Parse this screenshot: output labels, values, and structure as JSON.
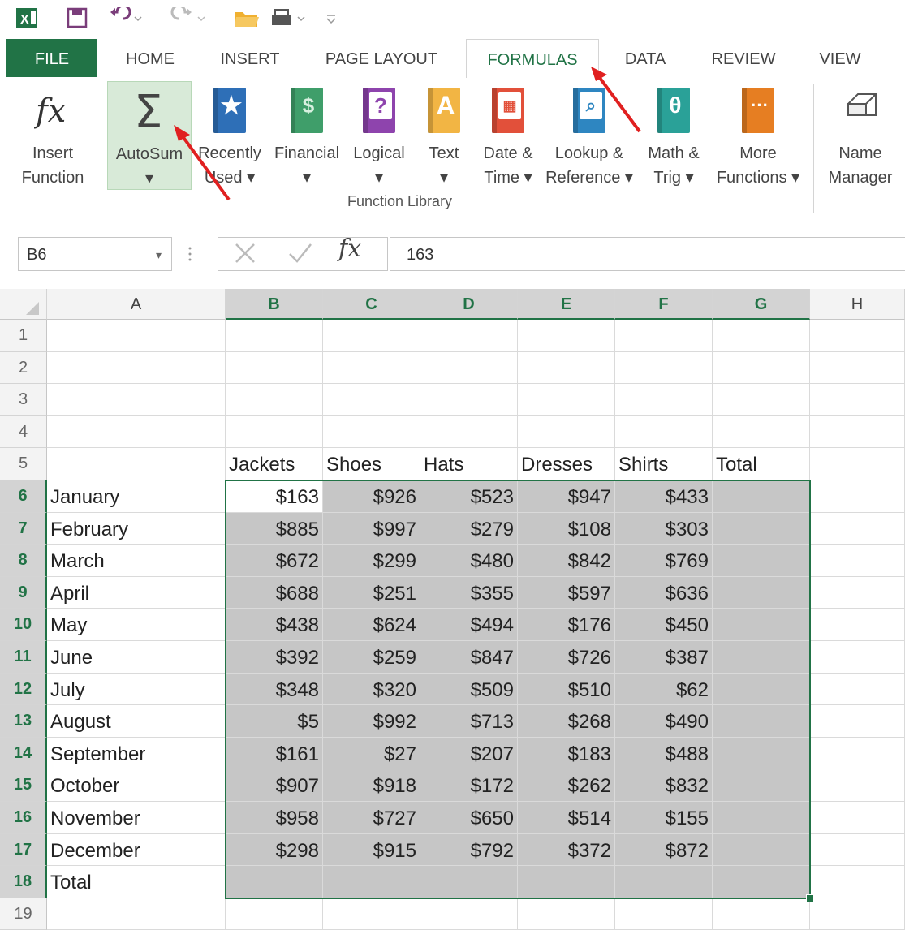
{
  "qat": {
    "icons": [
      "excel-logo-icon",
      "save-icon",
      "undo-icon",
      "redo-icon",
      "open-folder-icon",
      "print-icon",
      "customize-icon"
    ]
  },
  "tabs": [
    "FILE",
    "HOME",
    "INSERT",
    "PAGE LAYOUT",
    "FORMULAS",
    "DATA",
    "REVIEW",
    "VIEW"
  ],
  "active_tab": "FORMULAS",
  "ribbon": {
    "buttons": [
      {
        "label": "Insert\nFunction",
        "icon": "fx-icon"
      },
      {
        "label": "AutoSum\n▾",
        "icon": "sigma-icon"
      },
      {
        "label": "Recently\nUsed ▾",
        "icon": "star-book-icon"
      },
      {
        "label": "Financial\n▾",
        "icon": "financial-book-icon"
      },
      {
        "label": "Logical\n▾",
        "icon": "question-book-icon"
      },
      {
        "label": "Text\n▾",
        "icon": "text-book-icon"
      },
      {
        "label": "Date &\nTime ▾",
        "icon": "calendar-book-icon"
      },
      {
        "label": "Lookup &\nReference ▾",
        "icon": "magnifier-book-icon"
      },
      {
        "label": "Math &\nTrig ▾",
        "icon": "theta-book-icon"
      },
      {
        "label": "More\nFunctions ▾",
        "icon": "more-book-icon"
      },
      {
        "label": "Name\nManager",
        "icon": "name-manager-icon"
      }
    ],
    "group_label": "Function Library"
  },
  "formula_bar": {
    "name_box": "B6",
    "formula": "163",
    "fx": "fx"
  },
  "columns": [
    "A",
    "B",
    "C",
    "D",
    "E",
    "F",
    "G",
    "H"
  ],
  "rows": [
    "1",
    "2",
    "3",
    "4",
    "5",
    "6",
    "7",
    "8",
    "9",
    "10",
    "11",
    "12",
    "13",
    "14",
    "15",
    "16",
    "17",
    "18",
    "19"
  ],
  "headers": [
    "Jackets",
    "Shoes",
    "Hats",
    "Dresses",
    "Shirts",
    "Total"
  ],
  "months": [
    "January",
    "February",
    "March",
    "April",
    "May",
    "June",
    "July",
    "August",
    "September",
    "October",
    "November",
    "December",
    "Total"
  ],
  "values": [
    [
      "$163",
      "$926",
      "$523",
      "$947",
      "$433"
    ],
    [
      "$885",
      "$997",
      "$279",
      "$108",
      "$303"
    ],
    [
      "$672",
      "$299",
      "$480",
      "$842",
      "$769"
    ],
    [
      "$688",
      "$251",
      "$355",
      "$597",
      "$636"
    ],
    [
      "$438",
      "$624",
      "$494",
      "$176",
      "$450"
    ],
    [
      "$392",
      "$259",
      "$847",
      "$726",
      "$387"
    ],
    [
      "$348",
      "$320",
      "$509",
      "$510",
      "$62"
    ],
    [
      "$5",
      "$992",
      "$713",
      "$268",
      "$490"
    ],
    [
      "$161",
      "$27",
      "$207",
      "$183",
      "$488"
    ],
    [
      "$907",
      "$918",
      "$172",
      "$262",
      "$832"
    ],
    [
      "$958",
      "$727",
      "$650",
      "$514",
      "$155"
    ],
    [
      "$298",
      "$915",
      "$792",
      "$372",
      "$872"
    ]
  ],
  "colors": {
    "accent": "#217346",
    "selection": "#c6c6c6",
    "arrow": "#e02020"
  }
}
